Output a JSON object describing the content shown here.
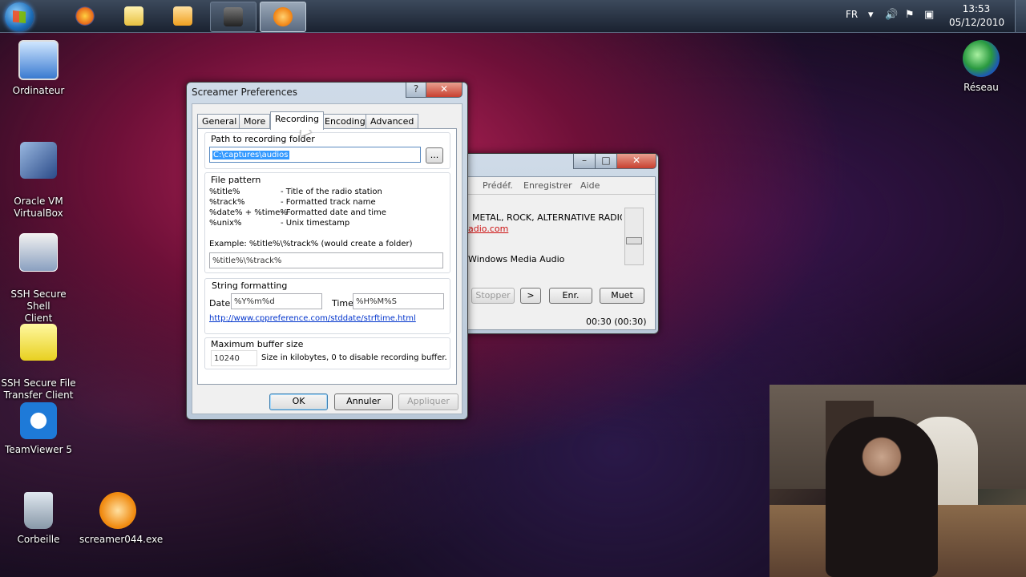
{
  "taskbar": {
    "items": [
      {
        "name": "firefox-icon",
        "color": "#e86a1a"
      },
      {
        "name": "explorer-folder-icon",
        "color": "#e8c040"
      },
      {
        "name": "media-player-icon",
        "color": "#f0a020"
      },
      {
        "name": "camera-app-icon",
        "color": "#333333"
      },
      {
        "name": "screamer-icon",
        "color": "#f08010"
      }
    ],
    "language": "FR",
    "time": "13:53",
    "date": "05/12/2010"
  },
  "desktop": {
    "icons": [
      {
        "label": "Ordinateur",
        "icon": "computer-icon"
      },
      {
        "label": "Oracle VM\nVirtualBox",
        "icon": "virtualbox-icon"
      },
      {
        "label": "SSH Secure Shell\nClient",
        "icon": "ssh-shell-icon"
      },
      {
        "label": "SSH Secure File\nTransfer Client",
        "icon": "ssh-transfer-icon"
      },
      {
        "label": "TeamViewer 5",
        "icon": "teamviewer-icon"
      },
      {
        "label": "Corbeille",
        "icon": "recycle-bin-icon"
      },
      {
        "label": "screamer044.exe",
        "icon": "screamer-exe-icon"
      },
      {
        "label": "Réseau",
        "icon": "network-globe-icon"
      }
    ]
  },
  "screamer_window": {
    "menu": [
      "Prédéf.",
      "Enregistrer",
      "Aide"
    ],
    "station": "METAL, ROCK, ALTERNATIVE RADIO",
    "link": "adio.com",
    "codec": "Windows Media Audio",
    "buttons": {
      "stop": "Stopper",
      "play": ">",
      "record": "Enr.",
      "mute": "Muet"
    },
    "time": "00:30 (00:30)"
  },
  "prefs_dialog": {
    "title": "Screamer Preferences",
    "help": "?",
    "close": "✕",
    "tabs": [
      "General",
      "More",
      "Recording",
      "Encoding",
      "Advanced"
    ],
    "selected_tab": "Recording",
    "path_label": "Path to recording folder",
    "path_value": "C:\\captures\\audios",
    "browse_label": "...",
    "file_pattern_label": "File pattern",
    "patterns": [
      {
        "key": "%title%",
        "desc": "- Title of the radio station"
      },
      {
        "key": "%track%",
        "desc": "- Formatted track name"
      },
      {
        "key": "%date% + %time%",
        "desc": "- Formatted date and time"
      },
      {
        "key": "%unix%",
        "desc": "- Unix timestamp"
      }
    ],
    "example_label": "Example: %title%\\%track% (would create a folder)",
    "pattern_value": "%title%\\%track%",
    "string_formatting_label": "String formatting",
    "date_label": "Date",
    "date_value": "%Y%m%d",
    "time_label": "Time",
    "time_value": "%H%M%S",
    "strftime_link": "http://www.cppreference.com/stddate/strftime.html",
    "buffer_label": "Maximum buffer size",
    "buffer_value": "10240",
    "buffer_desc": "Size in kilobytes, 0 to disable recording buffer.",
    "ok": "OK",
    "cancel": "Annuler",
    "apply": "Appliquer"
  }
}
